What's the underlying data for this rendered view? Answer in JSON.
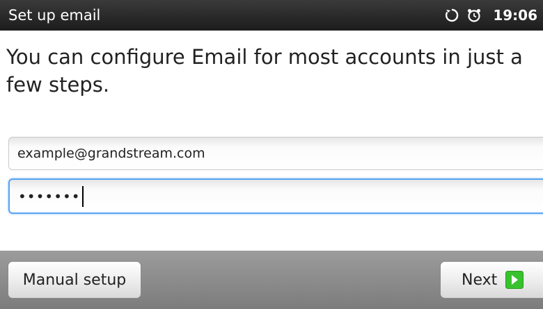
{
  "status_bar": {
    "title": "Set up email",
    "time": "19:06",
    "icons": [
      "sync-icon",
      "alarm-clock-icon"
    ]
  },
  "intro_text": "You can configure Email for most accounts in just a few steps.",
  "form": {
    "email_value": "example@grandstream.com",
    "password_value": "•••••••"
  },
  "buttons": {
    "manual_setup": "Manual setup",
    "next": "Next"
  },
  "colors": {
    "titlebar": "#1c1c1c",
    "focus_border": "#5aa3f0",
    "next_arrow": "#38c22e",
    "buttonbar": "#8a8a8a"
  }
}
